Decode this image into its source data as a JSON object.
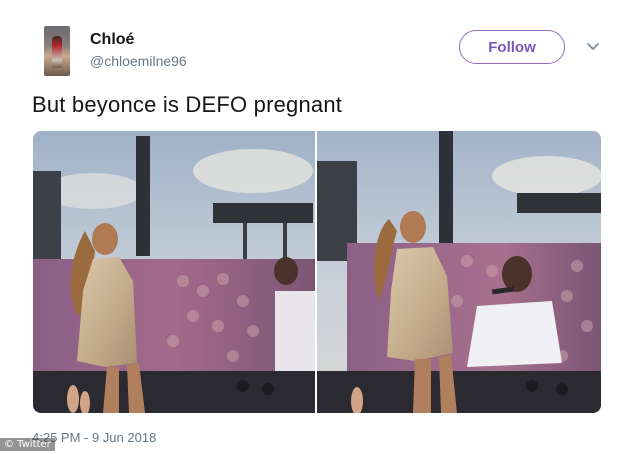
{
  "tweet": {
    "display_name": "Chloé",
    "handle": "@chloemilne96",
    "follow_label": "Follow",
    "text": "But beyonce is DEFO pregnant",
    "timestamp": "4:25 PM - 9 Jun 2018"
  },
  "watermark": "© Twitter",
  "icons": {
    "menu": "chevron-down-icon"
  },
  "colors": {
    "accent": "#7b56b8",
    "text_primary": "#14171a",
    "text_secondary": "#657786"
  }
}
